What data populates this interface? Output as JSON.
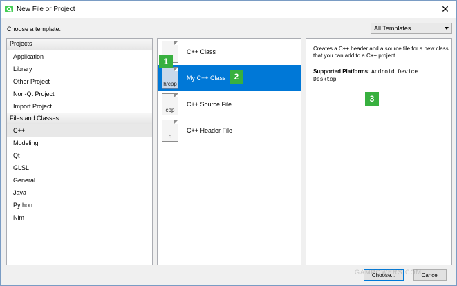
{
  "window": {
    "title": "New File or Project",
    "close_glyph": "✕"
  },
  "choose_label": "Choose a template:",
  "filter": {
    "selected": "All Templates"
  },
  "categories": {
    "projects_header": "Projects",
    "projects": [
      "Application",
      "Library",
      "Other Project",
      "Non-Qt Project",
      "Import Project"
    ],
    "files_header": "Files and Classes",
    "files": [
      "C++",
      "Modeling",
      "Qt",
      "GLSL",
      "General",
      "Java",
      "Python",
      "Nim"
    ],
    "selected": "C++"
  },
  "templates": [
    {
      "name": "C++ Class",
      "icon_label": "",
      "icon": "cpp-class-file-icon"
    },
    {
      "name": "My C++ Class",
      "icon_label": "h/cpp",
      "icon": "h-cpp-file-icon",
      "selected": true
    },
    {
      "name": "C++ Source File",
      "icon_label": "cpp",
      "icon": "cpp-file-icon"
    },
    {
      "name": "C++ Header File",
      "icon_label": "h",
      "icon": "h-file-icon"
    }
  ],
  "details": {
    "description": "Creates a C++ header and a source file for a new class that you can add to a C++ project.",
    "platforms_label": "Supported Platforms:",
    "platforms_line1": "Android Device",
    "platforms_line2": "Desktop"
  },
  "badges": {
    "one": "1",
    "two": "2",
    "three": "3"
  },
  "buttons": {
    "choose": "Choose...",
    "cancel": "Cancel"
  },
  "watermark": "GAMPOWERS.COM",
  "colors": {
    "selection": "#0078d7",
    "badge": "#38b03f",
    "app_icon": "#41cd52"
  }
}
